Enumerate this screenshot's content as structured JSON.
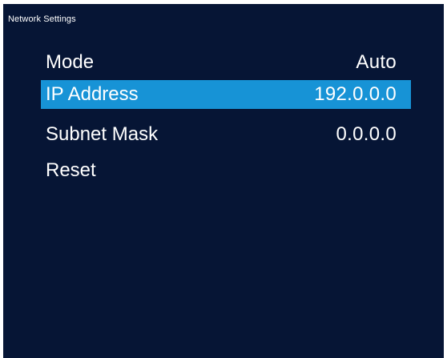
{
  "screen": {
    "title": "Network Settings",
    "colors": {
      "background": "#061535",
      "highlight": "#1793d6",
      "text": "#ffffff"
    }
  },
  "menu": {
    "selected_index": 1,
    "items": [
      {
        "label": "Mode",
        "value": "Auto"
      },
      {
        "label": "IP Address",
        "value": "192.0.0.0"
      },
      {
        "label": "Subnet Mask",
        "value": "0.0.0.0"
      },
      {
        "label": "Reset",
        "value": ""
      }
    ]
  }
}
